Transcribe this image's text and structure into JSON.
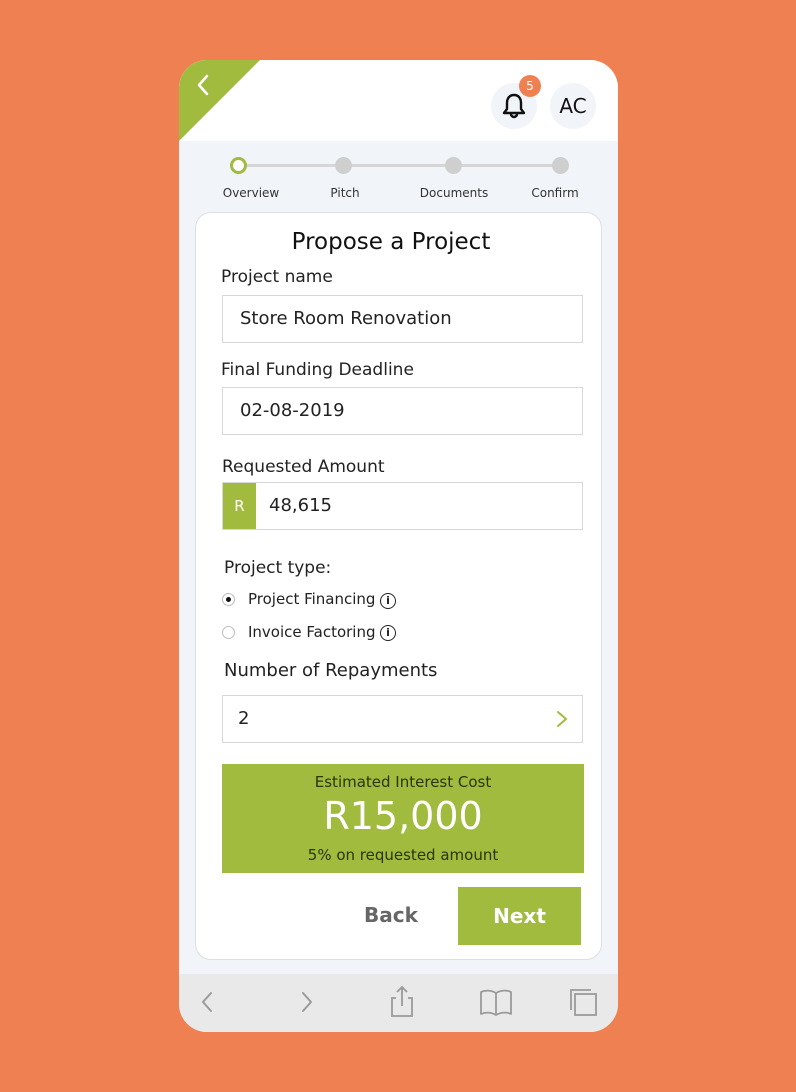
{
  "colors": {
    "background": "#EF8051",
    "accent": "#A0BB3E",
    "badge": "#EF8051"
  },
  "header": {
    "back_icon": "chevron-left-icon",
    "bell_icon": "bell-icon",
    "notification_count": "5",
    "avatar_initials": "AC"
  },
  "stepper": {
    "steps": [
      {
        "label": "Overview",
        "state": "active"
      },
      {
        "label": "Pitch",
        "state": "pending"
      },
      {
        "label": "Documents",
        "state": "pending"
      },
      {
        "label": "Confirm",
        "state": "pending"
      }
    ]
  },
  "form": {
    "title": "Propose a Project",
    "project_name": {
      "label": "Project name",
      "value": "Store Room Renovation"
    },
    "deadline": {
      "label": "Final Funding Deadline",
      "value": "02-08-2019"
    },
    "amount": {
      "label": "Requested Amount",
      "prefix": "R",
      "value": "48,615"
    },
    "project_type": {
      "label": "Project  type:",
      "options": [
        {
          "label": "Project Financing",
          "selected": true
        },
        {
          "label": "Invoice Factoring",
          "selected": false
        }
      ]
    },
    "repayments": {
      "label": "Number of Repayments",
      "value": "2"
    }
  },
  "estimate": {
    "label": "Estimated Interest Cost",
    "value": "R15,000",
    "sub": "5% on requested amount"
  },
  "actions": {
    "back_label": "Back",
    "next_label": "Next"
  },
  "browser_bar": {
    "icons": [
      "back-icon",
      "forward-icon",
      "share-icon",
      "bookmarks-icon",
      "tabs-icon"
    ]
  }
}
